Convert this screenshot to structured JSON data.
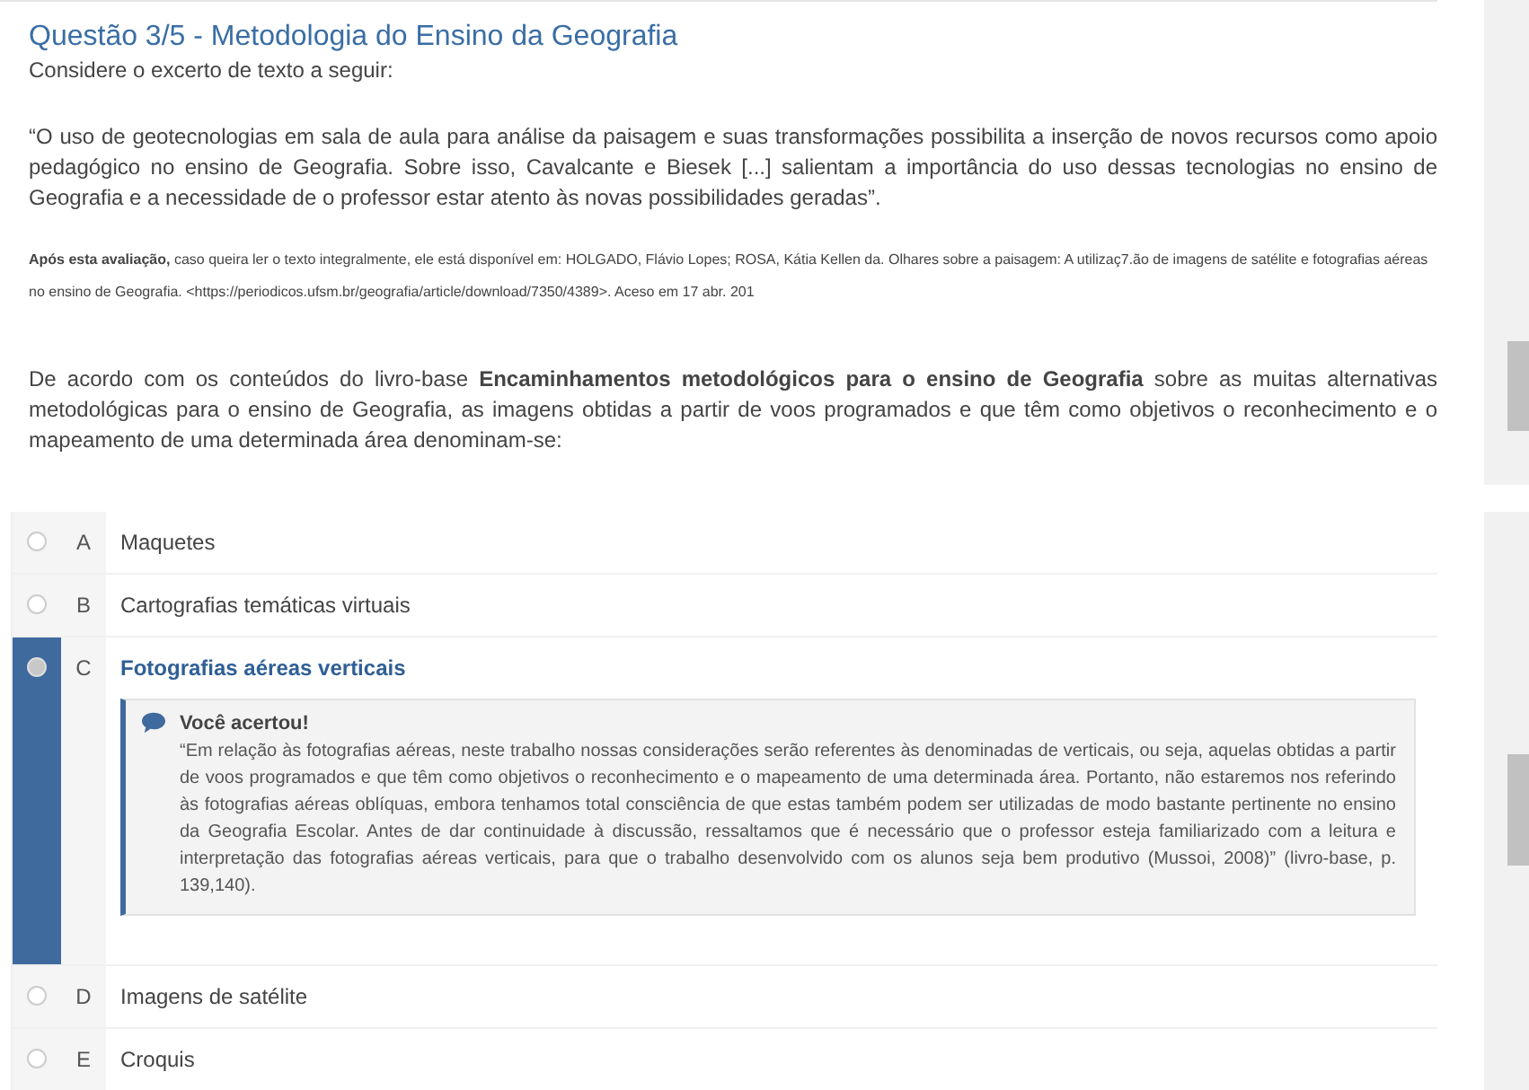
{
  "question": {
    "title": "Questão 3/5 - Metodologia do Ensino da Geografia",
    "intro": "Considere o excerto de texto a seguir:",
    "quote": "“O uso de geotecnologias em sala de aula para análise da paisagem e suas transformações possibilita a inserção de novos recursos como apoio pedagógico no ensino de Geografia. Sobre isso, Cavalcante e Biesek [...] salientam a importância do uso dessas tecnologias no ensino de Geografia e a necessidade de o professor estar atento às novas possibilidades geradas”.",
    "source": "**Após esta avaliação,** caso queira ler o texto integralmente, ele está disponível em: HOLGADO, Flávio Lopes; ROSA, Kátia Kellen da. Olhares sobre a paisagem: A utilizaç7.ão de imagens de satélite e fotografias aéreas no ensino de Geografia. <https://periodicos.ufsm.br/geografia/article/download/7350/4389>. Aceso em 17 abr. 201",
    "prompt": "De acordo com os conteúdos do livro-base **Encaminhamentos metodológicos para o ensino de Geografia** sobre as muitas alternativas metodológicas para o ensino de Geografia, as imagens obtidas a partir de voos programados e que têm como objetivos o reconhecimento e o mapeamento de uma determinada área denominam-se:"
  },
  "options": [
    {
      "letter": "A",
      "text": "Maquetes",
      "selected": false
    },
    {
      "letter": "B",
      "text": "Cartografias temáticas virtuais",
      "selected": false
    },
    {
      "letter": "C",
      "text": "Fotografias aéreas verticais",
      "selected": true,
      "feedback": {
        "title": "Você acertou!",
        "text": "“Em relação às fotografias aéreas, neste trabalho nossas considerações serão referentes às denominadas de verticais, ou seja, aquelas obtidas a partir de voos programados e que têm como objetivos o reconhecimento e o mapeamento de uma determinada área. Portanto, não estaremos nos referindo às fotografias aéreas oblíquas, embora tenhamos total consciência de que estas também podem ser utilizadas de modo bastante pertinente no ensino da Geografia Escolar. Antes de dar continuidade à discussão, ressaltamos que é necessário que o professor esteja familiarizado com a leitura e interpretação das fotografias aéreas verticais, para que o trabalho desenvolvido com os alunos seja bem produtivo (Mussoi, 2008)” (livro-base, p. 139,140)."
      }
    },
    {
      "letter": "D",
      "text": "Imagens de satélite",
      "selected": false
    },
    {
      "letter": "E",
      "text": "Croquis",
      "selected": false
    }
  ]
}
